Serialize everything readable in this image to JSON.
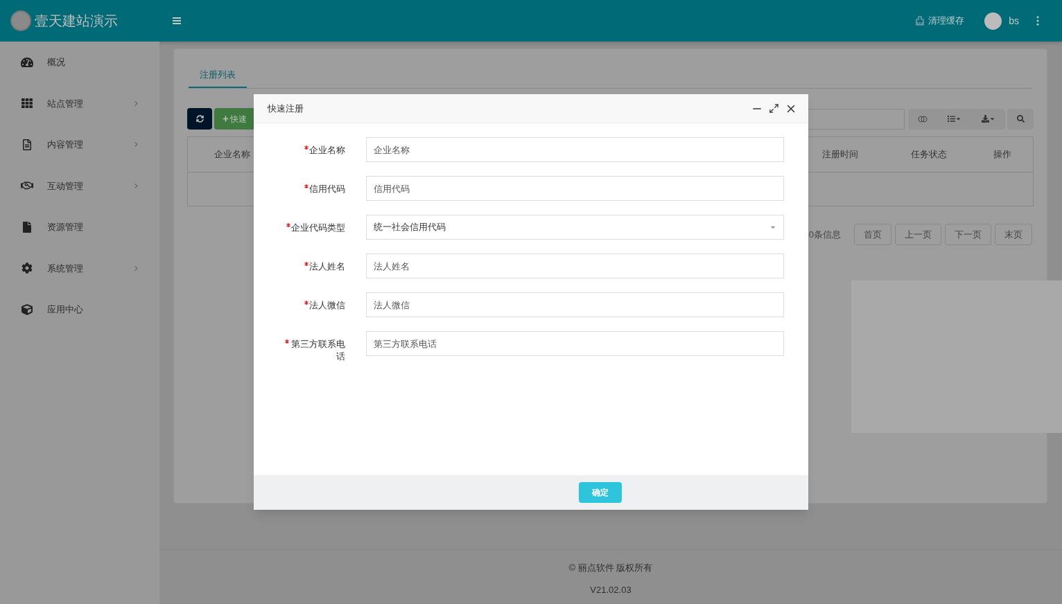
{
  "header": {
    "title": "壹天建站演示",
    "clear_cache": "清理缓存",
    "user": "bs"
  },
  "sidebar": {
    "items": [
      {
        "label": "概况",
        "has_children": false
      },
      {
        "label": "站点管理",
        "has_children": true
      },
      {
        "label": "内容管理",
        "has_children": true
      },
      {
        "label": "互动管理",
        "has_children": true
      },
      {
        "label": "资源管理",
        "has_children": false
      },
      {
        "label": "系统管理",
        "has_children": true
      },
      {
        "label": "应用中心",
        "has_children": false
      }
    ]
  },
  "tabs": [
    {
      "label": "注册列表",
      "selected": true
    }
  ],
  "toolbar": {
    "add_button": "快速"
  },
  "table": {
    "columns": [
      "企业名称",
      "注册时间",
      "任务状态",
      "操作"
    ]
  },
  "pagination": {
    "info": "0条信息",
    "buttons": [
      "首页",
      "上一页",
      "下一页",
      "末页"
    ]
  },
  "footer": {
    "copyright": "© 丽点软件 版权所有",
    "version": "V21.02.03"
  },
  "dialog": {
    "title": "快速注册",
    "fields": [
      {
        "label": "企业名称",
        "required": true,
        "kind": "input",
        "placeholder": "企业名称"
      },
      {
        "label": "信用代码",
        "required": true,
        "kind": "input",
        "placeholder": "信用代码"
      },
      {
        "label": "企业代码类型",
        "required": true,
        "kind": "select",
        "value": "统一社会信用代码"
      },
      {
        "label": "法人姓名",
        "required": true,
        "kind": "input",
        "placeholder": "法人姓名"
      },
      {
        "label": "法人微信",
        "required": true,
        "kind": "input",
        "placeholder": "法人微信"
      },
      {
        "label": "第三方联系电话",
        "required": true,
        "kind": "input",
        "placeholder": "第三方联系电话"
      }
    ],
    "confirm": "确定"
  }
}
